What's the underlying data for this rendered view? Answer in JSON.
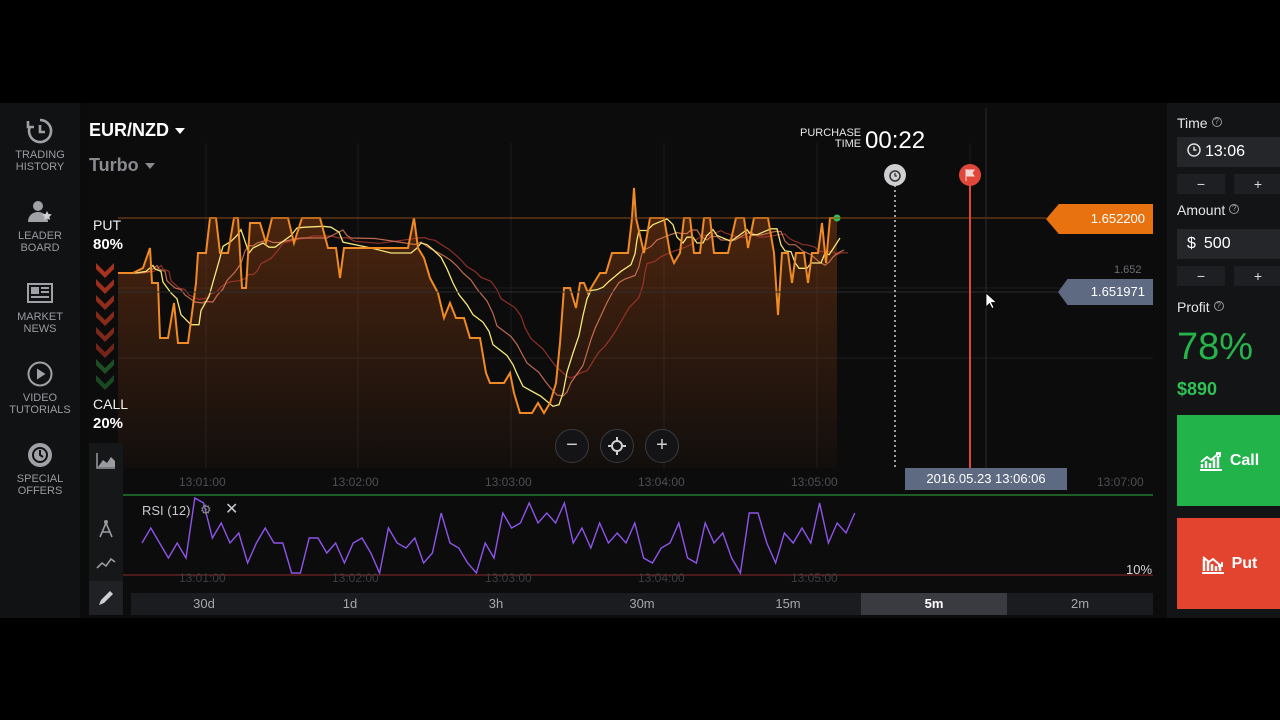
{
  "sidebar": {
    "items": [
      {
        "label": "TRADING\nHISTORY",
        "icon": "history-icon"
      },
      {
        "label": "LEADER\nBOARD",
        "icon": "leaderboard-icon"
      },
      {
        "label": "MARKET\nNEWS",
        "icon": "news-icon"
      },
      {
        "label": "VIDEO\nTUTORIALS",
        "icon": "play-icon"
      },
      {
        "label": "SPECIAL\nOFFERS",
        "icon": "offers-icon"
      }
    ]
  },
  "chart": {
    "asset": "EUR/NZD",
    "mode": "Turbo",
    "purchase_label_1": "PURCHASE",
    "purchase_label_2": "TIME",
    "purchase_time": "00:22",
    "put_label": "PUT",
    "put_pct": "80%",
    "call_label": "CALL",
    "call_pct": "20%",
    "current_price": "1.652200",
    "cursor_price": "1.651971",
    "axis_price": "1.652",
    "cursor_time": "2016.05.23 13:06:06",
    "x_ticks": [
      "13:01:00",
      "13:02:00",
      "13:03:00",
      "13:04:00",
      "13:05:00",
      "13:07:00"
    ],
    "indicator": "RSI (12)",
    "rsi_level": "10%",
    "zoom_out": "−",
    "zoom_in": "+",
    "colors": {
      "price": "#f08a24",
      "put_line": "#e8720f",
      "cursor": "#5d6a82",
      "rsi": "#8e54e9",
      "expiry": "#e0473a"
    }
  },
  "timeframes": {
    "items": [
      "30d",
      "1d",
      "3h",
      "30m",
      "15m",
      "5m",
      "2m"
    ],
    "active": "5m"
  },
  "panel": {
    "time_label": "Time",
    "time_value": "13:06",
    "amount_label": "Amount",
    "currency": "$",
    "amount_value": "500",
    "minus": "−",
    "plus": "+",
    "profit_label": "Profit",
    "profit_pct": "78%",
    "profit_amount": "$890",
    "call_button": "Call",
    "put_button": "Put",
    "help": "?"
  }
}
